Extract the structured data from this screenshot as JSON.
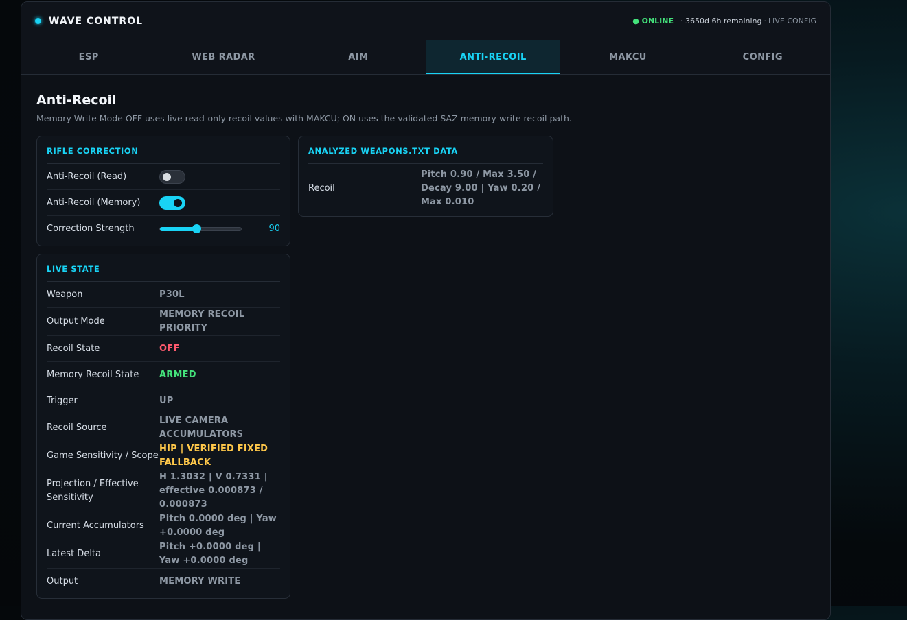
{
  "header": {
    "title": "WAVE CONTROL",
    "status_online": "● ONLINE",
    "status_remaining": "· 3650d 6h remaining",
    "status_sep": "·",
    "status_mode": "LIVE CONFIG"
  },
  "tabs": [
    {
      "label": "ESP"
    },
    {
      "label": "WEB RADAR"
    },
    {
      "label": "AIM"
    },
    {
      "label": "ANTI-RECOIL",
      "active": true
    },
    {
      "label": "MAKCU"
    },
    {
      "label": "CONFIG"
    }
  ],
  "page": {
    "title": "Anti-Recoil",
    "subtitle": "Memory Write Mode OFF uses live read-only recoil values with MAKCU; ON uses the validated SAZ memory-write recoil path."
  },
  "rifle_correction": {
    "title": "RIFLE CORRECTION",
    "read_label": "Anti-Recoil (Read)",
    "read_on": false,
    "memory_label": "Anti-Recoil (Memory)",
    "memory_on": true,
    "strength_label": "Correction Strength",
    "strength_value": "90",
    "strength_fraction": 0.45
  },
  "live_state": {
    "title": "LIVE STATE",
    "rows": [
      {
        "label": "Weapon",
        "value": "P30L"
      },
      {
        "label": "Output Mode",
        "value": "MEMORY RECOIL PRIORITY"
      },
      {
        "label": "Recoil State",
        "value": "OFF",
        "color": "red"
      },
      {
        "label": "Memory Recoil State",
        "value": "ARMED",
        "color": "green"
      },
      {
        "label": "Trigger",
        "value": "UP"
      },
      {
        "label": "Recoil Source",
        "value": "LIVE CAMERA ACCUMULATORS"
      },
      {
        "label": "Game Sensitivity / Scope",
        "value": "HIP | VERIFIED FIXED FALLBACK",
        "color": "yellow"
      },
      {
        "label": "Projection / Effective Sensitivity",
        "value": "H 1.3032 | V 0.7331 | effective 0.000873 / 0.000873"
      },
      {
        "label": "Current Accumulators",
        "value": "Pitch 0.0000 deg | Yaw +0.0000 deg"
      },
      {
        "label": "Latest Delta",
        "value": "Pitch +0.0000 deg | Yaw +0.0000 deg"
      },
      {
        "label": "Output",
        "value": "MEMORY WRITE"
      }
    ]
  },
  "weapons_data": {
    "title": "ANALYZED WEAPONS.TXT DATA",
    "label": "Recoil",
    "value": "Pitch 0.90 / Max 3.50 / Decay 9.00 | Yaw 0.20 / Max 0.010"
  }
}
